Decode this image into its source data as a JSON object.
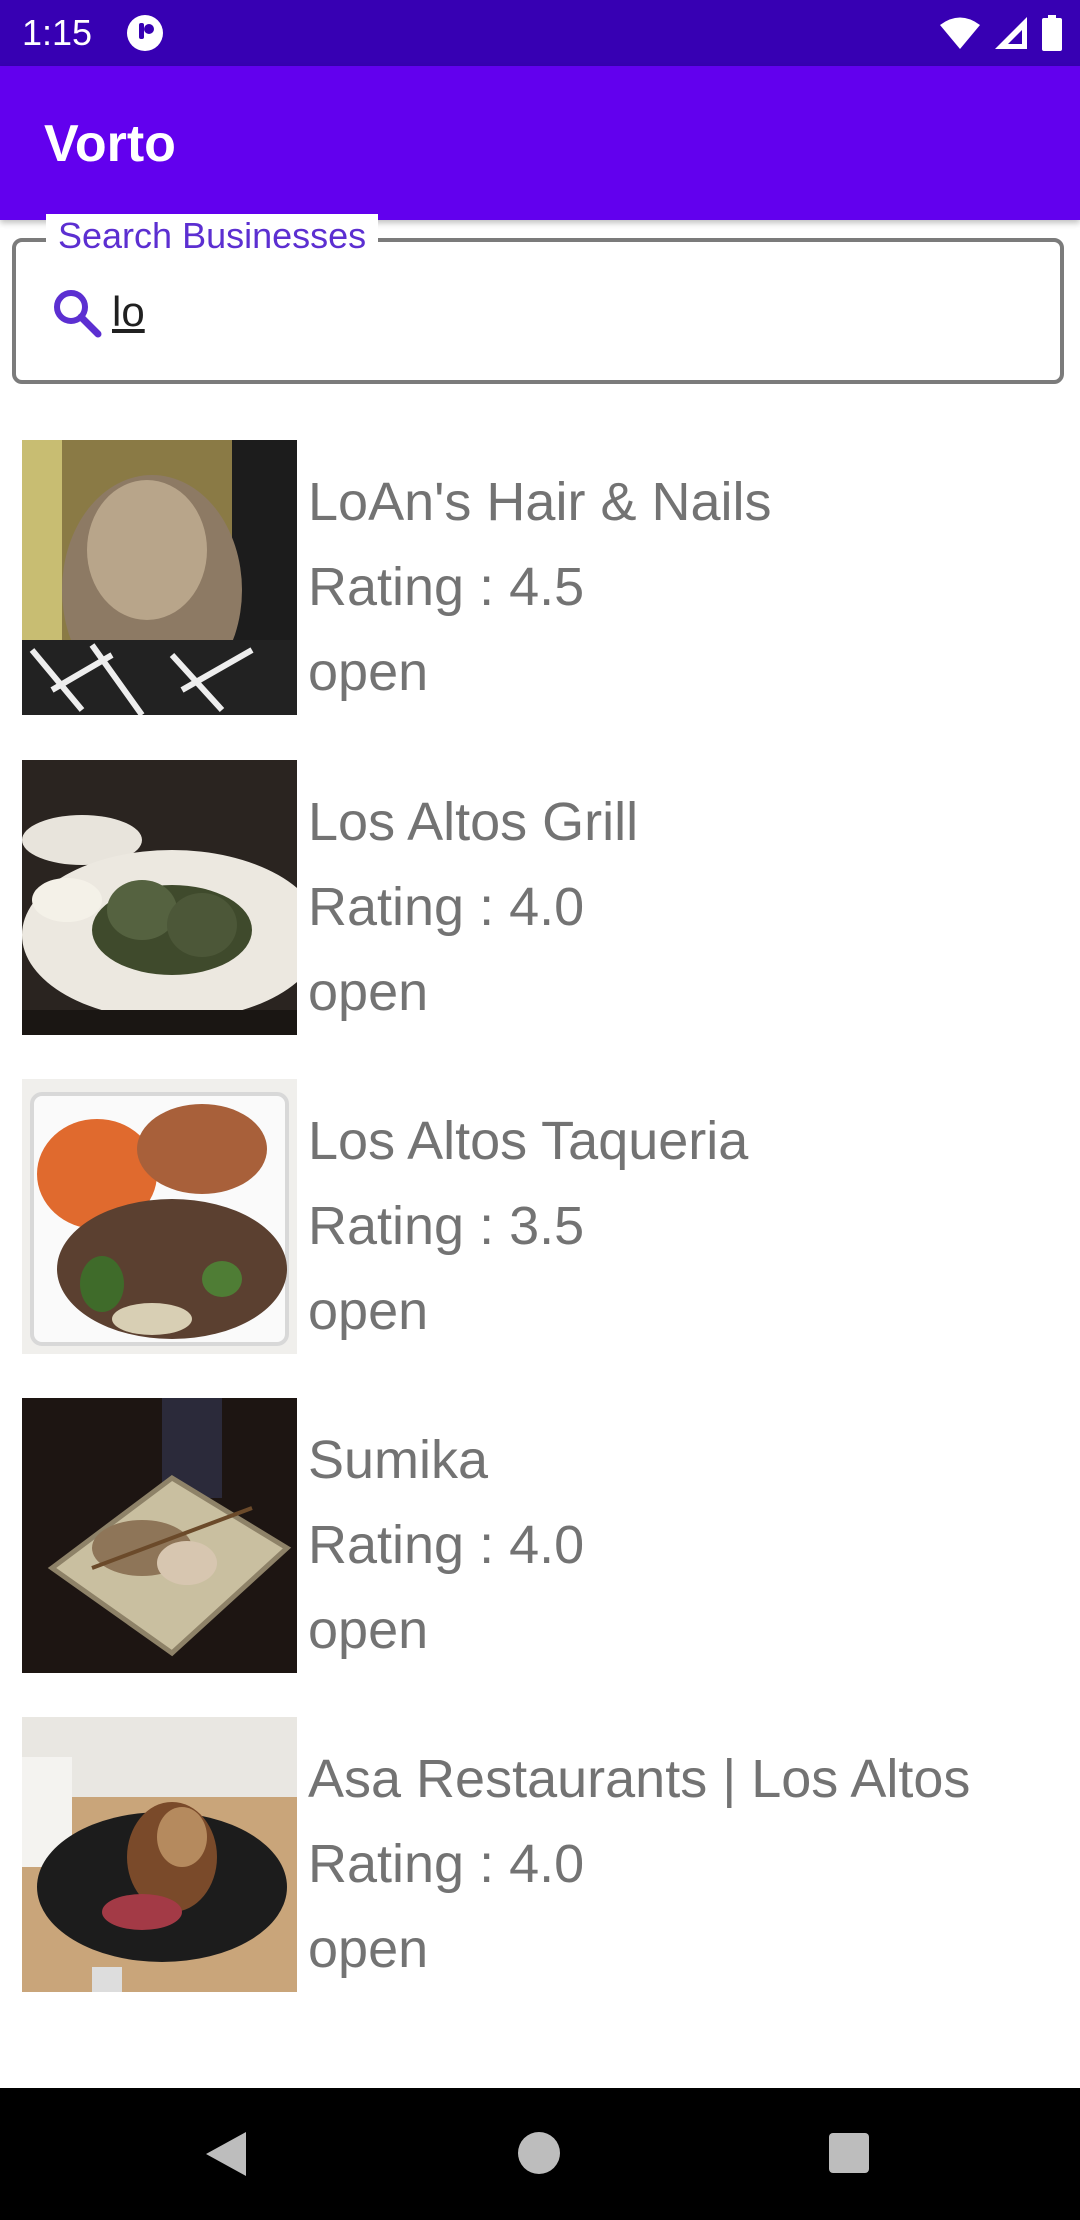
{
  "status_bar": {
    "time": "1:15"
  },
  "app_bar": {
    "title": "Vorto"
  },
  "search": {
    "label": "Search Businesses",
    "value": "lo"
  },
  "results": [
    {
      "name": "LoAn's Hair & Nails",
      "rating": "Rating : 4.5",
      "status": "open"
    },
    {
      "name": "Los Altos Grill",
      "rating": "Rating : 4.0",
      "status": "open"
    },
    {
      "name": "Los Altos Taqueria",
      "rating": "Rating : 3.5",
      "status": "open"
    },
    {
      "name": "Sumika",
      "rating": "Rating : 4.0",
      "status": "open"
    },
    {
      "name": "Asa Restaurants | Los Altos",
      "rating": "Rating : 4.0",
      "status": "open"
    }
  ],
  "colors": {
    "status_bar": "#3700b3",
    "app_bar": "#6200ee",
    "search_label": "#5c2fd1",
    "list_text": "#737373"
  },
  "icons": {
    "search": "search-icon",
    "wifi": "wifi-icon",
    "signal": "cell-signal-icon",
    "battery": "battery-icon",
    "back": "nav-back-icon",
    "home": "nav-home-icon",
    "recents": "nav-recents-icon"
  }
}
